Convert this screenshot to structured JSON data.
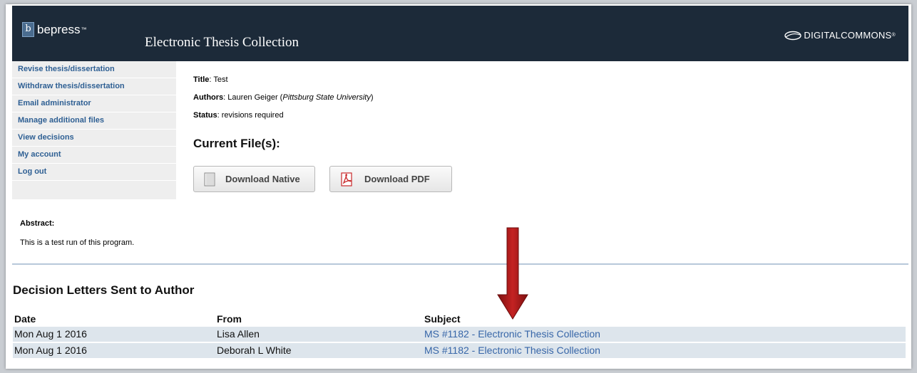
{
  "header": {
    "brand": "bepress",
    "brand_tm": "™",
    "brand_box": "b",
    "site_title": "Electronic Thesis Collection",
    "partner_logo": "DIGITALCOMMONS",
    "partner_mark": "®"
  },
  "sidebar": {
    "items": [
      {
        "label": "Revise thesis/dissertation"
      },
      {
        "label": "Withdraw thesis/dissertation"
      },
      {
        "label": "Email administrator"
      },
      {
        "label": "Manage additional files"
      },
      {
        "label": "View decisions"
      },
      {
        "label": "My account"
      },
      {
        "label": "Log out"
      }
    ]
  },
  "submission": {
    "title_label": "Title",
    "title": "Test",
    "authors_label": "Authors",
    "author_name": "Lauren Geiger",
    "author_affiliation": "Pittsburg State University",
    "status_label": "Status",
    "status": "revisions required"
  },
  "files": {
    "heading": "Current File(s):",
    "native_button": "Download Native",
    "pdf_button": "Download PDF"
  },
  "abstract": {
    "heading": "Abstract:",
    "text": "This is a test run of this program."
  },
  "decisions": {
    "heading": "Decision Letters Sent to Author",
    "columns": [
      "Date",
      "From",
      "Subject"
    ],
    "rows": [
      {
        "date": "Mon Aug 1 2016",
        "from": "Lisa Allen",
        "subject": "MS #1182 - Electronic Thesis Collection"
      },
      {
        "date": "Mon Aug 1 2016",
        "from": "Deborah L White",
        "subject": "MS #1182 - Electronic Thesis Collection"
      }
    ]
  },
  "colors": {
    "header_bg": "#1c2a39",
    "sidebar_link": "#2e5f93",
    "table_link": "#3766a8",
    "row_bg": "#dde5ec",
    "arrow": "#b01c1c"
  },
  "icons": [
    "document-icon",
    "pdf-icon",
    "down-arrow-annotation"
  ]
}
